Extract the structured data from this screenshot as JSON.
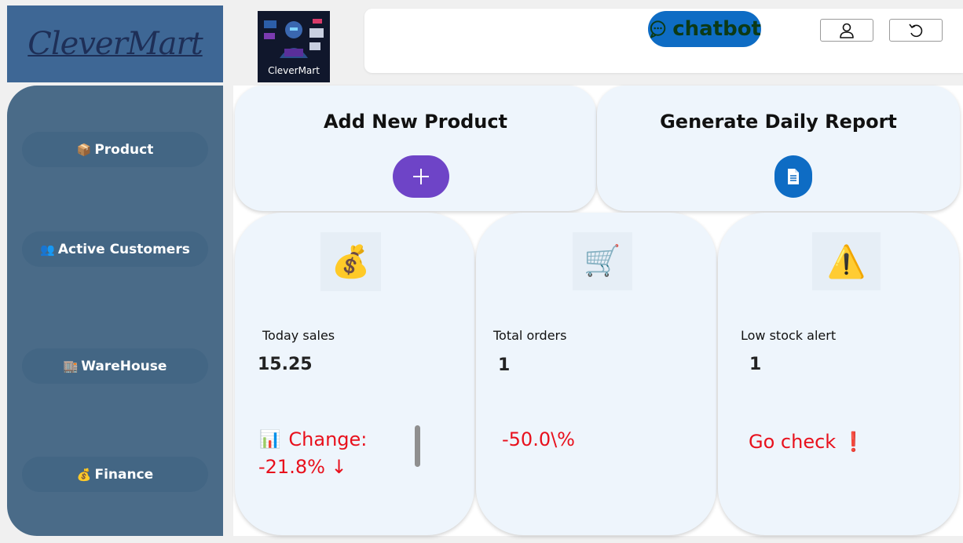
{
  "brand": {
    "logo_text": "CleverMart",
    "image_caption": "CleverMart"
  },
  "header": {
    "chatbot_label": "chatbot",
    "profile_icon": "user-icon",
    "refresh_icon": "undo-icon"
  },
  "sidebar": {
    "items": [
      {
        "emoji": "📦",
        "label": "Product"
      },
      {
        "emoji": "👥",
        "label": "Active Customers"
      },
      {
        "emoji": "🏬",
        "label": "WareHouse"
      },
      {
        "emoji": "💰",
        "label": "Finance"
      }
    ]
  },
  "actions": {
    "add_product": {
      "title": "Add New Product",
      "icon": "plus-icon"
    },
    "daily_report": {
      "title": "Generate Daily Report",
      "icon": "document-icon"
    }
  },
  "stats": {
    "sales": {
      "icon": "money-bag-icon",
      "emoji": "💰",
      "label": "Today sales",
      "value": "15.25",
      "change_emoji": "📊",
      "change_label": "Change:",
      "change_value": "-21.8% ↓"
    },
    "orders": {
      "icon": "shopping-cart-icon",
      "emoji": "🛒",
      "label": "Total orders",
      "value": "1",
      "change_value": "-50.0\\%"
    },
    "stock": {
      "icon": "warning-icon",
      "emoji": "⚠️",
      "label": "Low stock alert",
      "value": "1",
      "action_text": "Go check ❗"
    }
  },
  "colors": {
    "accent": "#0e6cc4",
    "add_button": "#6e44c7",
    "alert_red": "#e8101c",
    "sidebar": "#4a6b88",
    "card": "#eef5fc"
  }
}
